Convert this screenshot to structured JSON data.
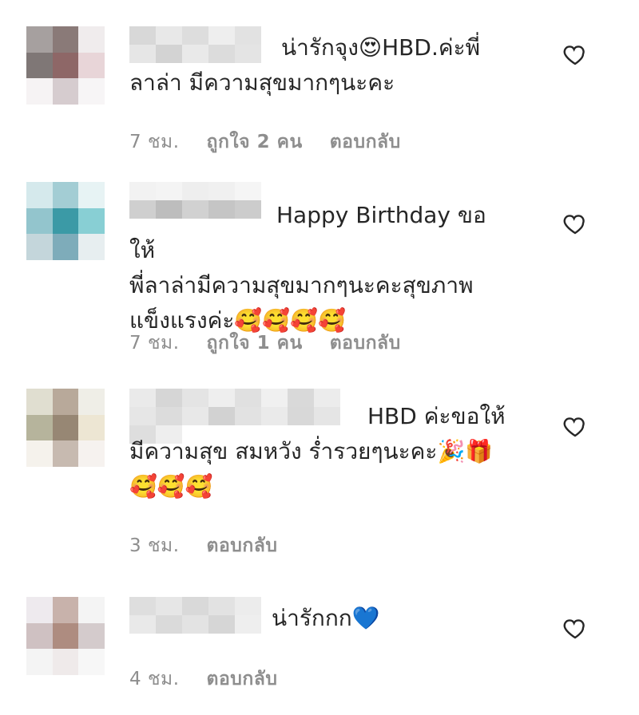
{
  "comments": [
    {
      "text": "น่ารักจุง😍HBD.ค่ะพี่\nลาล่า มีความสุขมากๆนะคะ",
      "time": "7 ชม.",
      "likes": "ถูกใจ 2 คน",
      "reply": "ตอบกลับ",
      "avatar_colors": [
        "#a6a09f",
        "#8a7a78",
        "#f0eced",
        "#7f7776",
        "#8e6767",
        "#e8d5d8",
        "#f6f3f4",
        "#d6cccf",
        "#f7f5f6"
      ]
    },
    {
      "text": "Happy Birthday ขอให้\nพี่ลาล่ามีความสุขมากๆนะคะสุขภาพ\nแข็งแรงค่ะ🥰🥰🥰🥰",
      "time": "7 ชม.",
      "likes": "ถูกใจ 1 คน",
      "reply": "ตอบกลับ",
      "avatar_colors": [
        "#d5e9ec",
        "#a3cdd4",
        "#e7f3f4",
        "#93c5cd",
        "#3b9aa6",
        "#88cfd4",
        "#c4d6db",
        "#7eacba",
        "#e7eef0"
      ]
    },
    {
      "text": "HBD ค่ะขอให้\nมีความสุข สมหวัง ร่ำรวยๆนะคะ🎉🎁\n🥰🥰🥰",
      "time": "3 ชม.",
      "likes": "",
      "reply": "ตอบกลับ",
      "avatar_colors": [
        "#e0ded0",
        "#b8a99a",
        "#efeee7",
        "#b6b49c",
        "#978774",
        "#ede6d3",
        "#f5f2ec",
        "#c7bab0",
        "#f6f2ef"
      ]
    },
    {
      "text": "น่ารักกก💙",
      "time": "4 ชม.",
      "likes": "",
      "reply": "ตอบกลับ",
      "avatar_colors": [
        "#eeeaee",
        "#c8b2ab",
        "#f4f4f4",
        "#cfc1c2",
        "#ae8c80",
        "#d4cbcc",
        "#f4f4f4",
        "#efeaea",
        "#f7f7f7"
      ]
    }
  ]
}
